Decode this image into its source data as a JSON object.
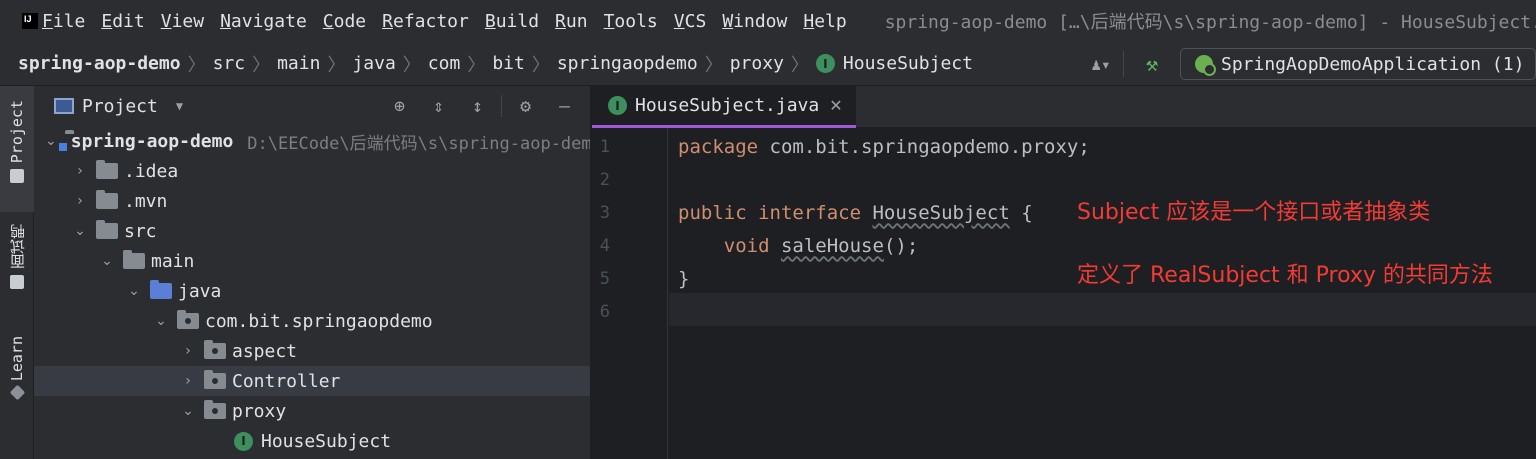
{
  "menubar": {
    "logo_text": "IJ",
    "items": [
      "File",
      "Edit",
      "View",
      "Navigate",
      "Code",
      "Refactor",
      "Build",
      "Run",
      "Tools",
      "VCS",
      "Window",
      "Help"
    ],
    "title": "spring-aop-demo […\\后端代码\\s\\spring-aop-demo] - HouseSubject.java"
  },
  "navbar": {
    "breadcrumbs": [
      "spring-aop-demo",
      "src",
      "main",
      "java",
      "com",
      "bit",
      "springaopdemo",
      "proxy"
    ],
    "current_badge": "I",
    "current": "HouseSubject",
    "run_config": "SpringAopDemoApplication (1)"
  },
  "stripe": {
    "project_label": "Project",
    "mianshi_label": "面试鸭",
    "learn_label": "Learn"
  },
  "project_panel": {
    "title": "Project",
    "tree": [
      {
        "label": "spring-aop-demo",
        "path": "D:\\EECode\\后端代码\\s\\spring-aop-demo"
      },
      {
        "label": ".idea"
      },
      {
        "label": ".mvn"
      },
      {
        "label": "src"
      },
      {
        "label": "main"
      },
      {
        "label": "java"
      },
      {
        "label": "com.bit.springaopdemo"
      },
      {
        "label": "aspect"
      },
      {
        "label": "Controller"
      },
      {
        "label": "proxy"
      },
      {
        "label": "HouseSubject",
        "badge": "I"
      }
    ]
  },
  "editor": {
    "tab": {
      "name": "HouseSubject.java",
      "badge": "I"
    },
    "line_numbers": [
      "1",
      "2",
      "3",
      "4",
      "5",
      "6"
    ],
    "code": {
      "l1_kw": "package",
      "l1_rest": " com.bit.springaopdemo.proxy;",
      "l3_kw": "public interface",
      "l3_name": "HouseSubject",
      "l3_brace": " {",
      "l4_indent": "    ",
      "l4_kw": "void",
      "l4_method": "saleHouse",
      "l4_rest": "();",
      "l5": "}"
    },
    "annotations": [
      "Subject 应该是一个接口或者抽象类",
      "定义了 RealSubject 和 Proxy 的共同方法"
    ]
  },
  "colors": {
    "accent_tab": "#a259d9",
    "keyword": "#cf8e6d",
    "annotation_red": "#f23b34",
    "interface_badge": "#3e8f5e"
  }
}
